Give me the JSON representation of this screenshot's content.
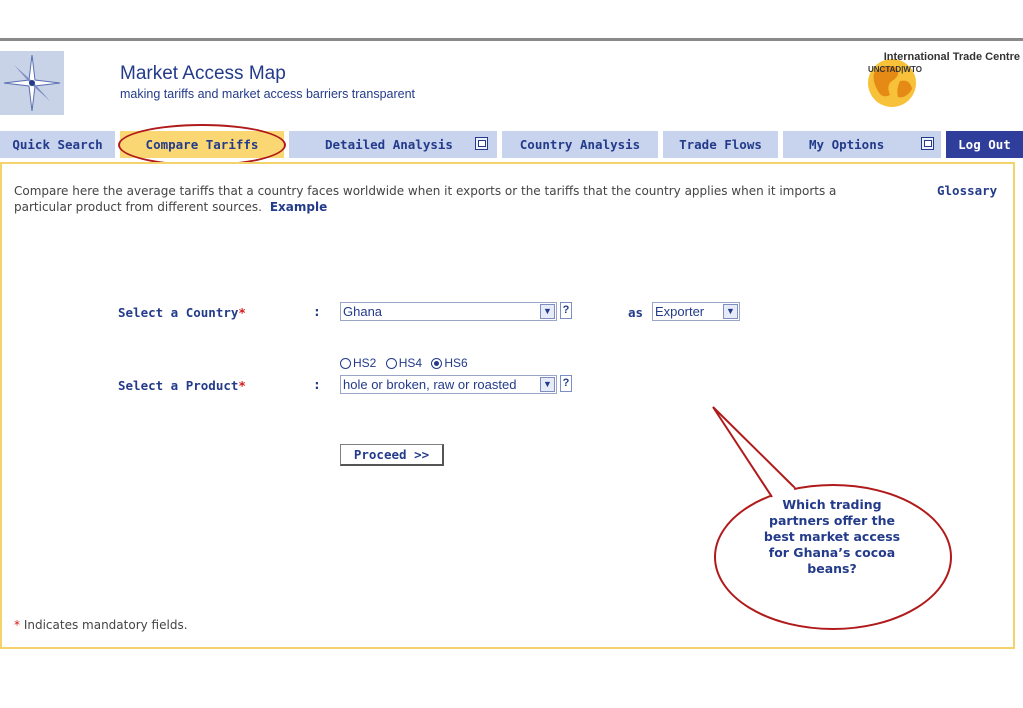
{
  "header": {
    "title": "Market Access Map",
    "subtitle": "making tariffs and market access barriers transparent",
    "org_name": "International Trade Centre",
    "org_sub": "UNCTAD|WTO"
  },
  "nav": {
    "tabs": [
      {
        "label": "Quick Search"
      },
      {
        "label": "Compare Tariffs",
        "active": true
      },
      {
        "label": "Detailed Analysis"
      },
      {
        "label": "Country Analysis"
      },
      {
        "label": "Trade Flows"
      },
      {
        "label": "My Options"
      },
      {
        "label": "Log Out"
      }
    ]
  },
  "main": {
    "intro": "Compare here the average tariffs that a country faces worldwide when it exports or the tariffs that the country applies when it imports a particular product from different sources.",
    "example_link": "Example",
    "glossary_link": "Glossary",
    "country_label": "Select a Country",
    "product_label": "Select a Product",
    "required_mark": "*",
    "colon": ":",
    "country_value": "Ghana",
    "help_mark": "?",
    "as_label": "as",
    "role_value": "Exporter",
    "hs_options": [
      {
        "label": "HS2",
        "selected": false
      },
      {
        "label": "HS4",
        "selected": false
      },
      {
        "label": "HS6",
        "selected": true
      }
    ],
    "product_value": "hole or broken, raw or roasted",
    "proceed_label": "Proceed >>",
    "mandatory_note": "Indicates mandatory fields."
  },
  "callout": {
    "text": "Which trading partners offer the best market access for Ghana’s cocoa beans?"
  },
  "colors": {
    "nav_tab": "#c8d3ee",
    "active_tab": "#fbd773",
    "logout_tab": "#2f3e9a",
    "text_blue": "#233b8a",
    "annotation_red": "#b11a1a",
    "panel_border": "#f5d36b"
  }
}
